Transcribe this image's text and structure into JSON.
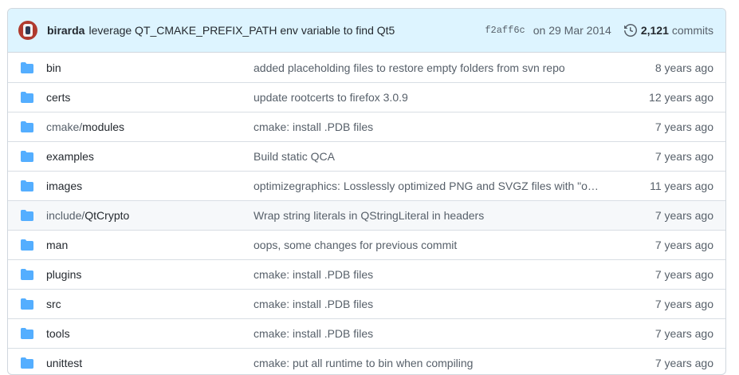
{
  "latest_commit": {
    "author": "birarda",
    "message": "leverage QT_CMAKE_PREFIX_PATH env variable to find Qt5",
    "sha": "f2aff6c",
    "date": "on 29 Mar 2014",
    "commits_count": "2,121",
    "commits_label": "commits"
  },
  "colors": {
    "header_bg": "#ddf4ff",
    "folder": "#54aeff",
    "border": "#d0d7de"
  },
  "files": [
    {
      "prefix": "",
      "name": "bin",
      "message": "added placeholding files to restore empty folders from svn repo",
      "age": "8 years ago"
    },
    {
      "prefix": "",
      "name": "certs",
      "message": "update rootcerts to firefox 3.0.9",
      "age": "12 years ago"
    },
    {
      "prefix": "cmake/",
      "name": "modules",
      "message": "cmake: install .PDB files",
      "age": "7 years ago"
    },
    {
      "prefix": "",
      "name": "examples",
      "message": "Build static QCA",
      "age": "7 years ago"
    },
    {
      "prefix": "",
      "name": "images",
      "message": "optimizegraphics: Losslessly optimized PNG and SVGZ files with \"optip…",
      "age": "11 years ago"
    },
    {
      "prefix": "include/",
      "name": "QtCrypto",
      "message": "Wrap string literals in QStringLiteral in headers",
      "age": "7 years ago"
    },
    {
      "prefix": "",
      "name": "man",
      "message": "oops, some changes for previous commit",
      "age": "7 years ago"
    },
    {
      "prefix": "",
      "name": "plugins",
      "message": "cmake: install .PDB files",
      "age": "7 years ago"
    },
    {
      "prefix": "",
      "name": "src",
      "message": "cmake: install .PDB files",
      "age": "7 years ago"
    },
    {
      "prefix": "",
      "name": "tools",
      "message": "cmake: install .PDB files",
      "age": "7 years ago"
    },
    {
      "prefix": "",
      "name": "unittest",
      "message": "cmake: put all runtime to bin when compiling",
      "age": "7 years ago"
    }
  ]
}
